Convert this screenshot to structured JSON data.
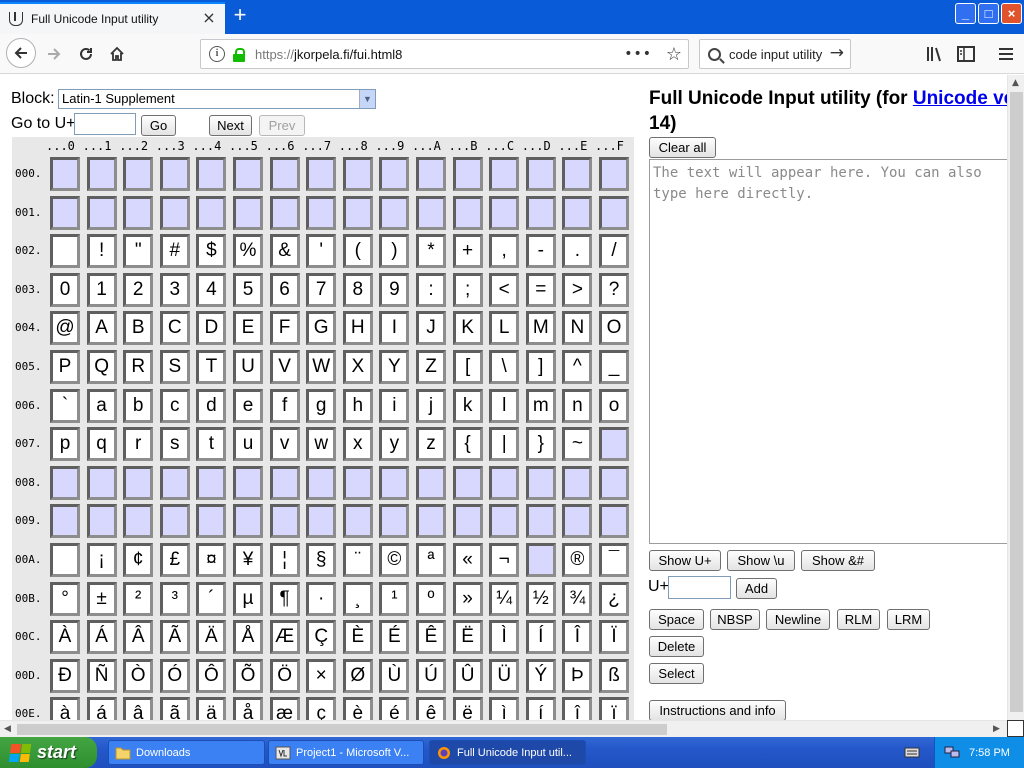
{
  "browser": {
    "tab_title": "Full Unicode Input utility",
    "tab_close": "×",
    "new_tab": "+",
    "window_controls": {
      "minimize": "_",
      "maximize": "□",
      "close": "×"
    },
    "url_prefix": "https://",
    "url_rest": "jkorpela.fi/fui.html8",
    "page_actions": "•••",
    "bookmark_star": "☆",
    "search_text": "code input utility",
    "search_go": "→"
  },
  "controls": {
    "block_label": "Block:",
    "block_value": "Latin-1 Supplement",
    "goto_label": "Go to U+",
    "go_button": "Go",
    "next_button": "Next",
    "prev_button": "Prev"
  },
  "grid": {
    "column_headers": [
      "...0",
      "...1",
      "...2",
      "...3",
      "...4",
      "...5",
      "...6",
      "...7",
      "...8",
      "...9",
      "...A",
      "...B",
      "...C",
      "...D",
      "...E",
      "...F"
    ],
    "rows": [
      {
        "label": "000.",
        "chars": [
          "",
          "",
          "",
          "",
          "",
          "",
          "",
          "",
          "",
          "",
          "",
          "",
          "",
          "",
          "",
          ""
        ]
      },
      {
        "label": "001.",
        "chars": [
          "",
          "",
          "",
          "",
          "",
          "",
          "",
          "",
          "",
          "",
          "",
          "",
          "",
          "",
          "",
          ""
        ]
      },
      {
        "label": "002.",
        "chars": [
          " ",
          "!",
          "\"",
          "#",
          "$",
          "%",
          "&",
          "'",
          "(",
          ")",
          "*",
          "+",
          ",",
          "-",
          ".",
          "/"
        ]
      },
      {
        "label": "003.",
        "chars": [
          "0",
          "1",
          "2",
          "3",
          "4",
          "5",
          "6",
          "7",
          "8",
          "9",
          ":",
          ";",
          "<",
          "=",
          ">",
          "?"
        ]
      },
      {
        "label": "004.",
        "chars": [
          "@",
          "A",
          "B",
          "C",
          "D",
          "E",
          "F",
          "G",
          "H",
          "I",
          "J",
          "K",
          "L",
          "M",
          "N",
          "O"
        ]
      },
      {
        "label": "005.",
        "chars": [
          "P",
          "Q",
          "R",
          "S",
          "T",
          "U",
          "V",
          "W",
          "X",
          "Y",
          "Z",
          "[",
          "\\",
          "]",
          "^",
          "_"
        ]
      },
      {
        "label": "006.",
        "chars": [
          "`",
          "a",
          "b",
          "c",
          "d",
          "e",
          "f",
          "g",
          "h",
          "i",
          "j",
          "k",
          "l",
          "m",
          "n",
          "o"
        ]
      },
      {
        "label": "007.",
        "chars": [
          "p",
          "q",
          "r",
          "s",
          "t",
          "u",
          "v",
          "w",
          "x",
          "y",
          "z",
          "{",
          "|",
          "}",
          "~",
          ""
        ]
      },
      {
        "label": "008.",
        "chars": [
          "",
          "",
          "",
          "",
          "",
          "",
          "",
          "",
          "",
          "",
          "",
          "",
          "",
          "",
          "",
          ""
        ]
      },
      {
        "label": "009.",
        "chars": [
          "",
          "",
          "",
          "",
          "",
          "",
          "",
          "",
          "",
          "",
          "",
          "",
          "",
          "",
          "",
          ""
        ]
      },
      {
        "label": "00A.",
        "chars": [
          " ",
          "¡",
          "¢",
          "£",
          "¤",
          "¥",
          "¦",
          "§",
          "¨",
          "©",
          "ª",
          "«",
          "¬",
          "",
          "®",
          "¯"
        ]
      },
      {
        "label": "00B.",
        "chars": [
          "°",
          "±",
          "²",
          "³",
          "´",
          "µ",
          "¶",
          "·",
          "¸",
          "¹",
          "º",
          "»",
          "¼",
          "½",
          "¾",
          "¿"
        ]
      },
      {
        "label": "00C.",
        "chars": [
          "À",
          "Á",
          "Â",
          "Ã",
          "Ä",
          "Å",
          "Æ",
          "Ç",
          "È",
          "É",
          "Ê",
          "Ë",
          "Ì",
          "Í",
          "Î",
          "Ï"
        ]
      },
      {
        "label": "00D.",
        "chars": [
          "Ð",
          "Ñ",
          "Ò",
          "Ó",
          "Ô",
          "Õ",
          "Ö",
          "×",
          "Ø",
          "Ù",
          "Ú",
          "Û",
          "Ü",
          "Ý",
          "Þ",
          "ß"
        ]
      },
      {
        "label": "00E.",
        "chars": [
          "à",
          "á",
          "â",
          "ã",
          "ä",
          "å",
          "æ",
          "ç",
          "è",
          "é",
          "ê",
          "ë",
          "ì",
          "í",
          "î",
          "ï"
        ]
      }
    ],
    "empty_cell_color": "#d8d8ff"
  },
  "right": {
    "title_prefix": "Full Unicode Input utility (for ",
    "title_link": "Unicode ve",
    "title_line2": "14)",
    "clear_all": "Clear all",
    "text_placeholder": "The text will appear here. You can also type here directly.",
    "show_u": "Show U+",
    "show_escape": "Show \\u",
    "show_entity": "Show &#",
    "uplus_label": "U+",
    "add_button": "Add",
    "space": "Space",
    "nbsp": "NBSP",
    "newline": "Newline",
    "rlm": "RLM",
    "lrm": "LRM",
    "delete": "Delete",
    "select": "Select",
    "instructions": "Instructions and info"
  },
  "taskbar": {
    "start": "start",
    "tasks": [
      {
        "label": "Downloads",
        "active": false
      },
      {
        "label": "Project1 - Microsoft V...",
        "active": false
      },
      {
        "label": "Full Unicode Input util...",
        "active": true
      }
    ],
    "clock": "7:58 PM"
  },
  "colors": {
    "link": "#0000ee",
    "titlebar": "#0a5bd8",
    "taskbar": "#2457c9",
    "start_button": "#3a9a3a"
  }
}
